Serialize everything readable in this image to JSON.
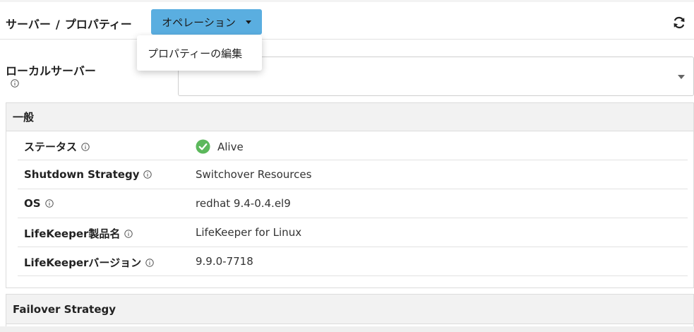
{
  "header": {
    "breadcrumb": [
      "サーバー",
      "プロパティー"
    ],
    "breadcrumb_separator": "/",
    "operation_button": "オペレーション",
    "refresh_icon": "refresh-icon"
  },
  "dropdown": {
    "items": [
      "プロパティーの編集"
    ]
  },
  "local_server": {
    "label": "ローカルサーバー",
    "value": ""
  },
  "general": {
    "title": "一般",
    "rows": [
      {
        "label": "ステータス",
        "value": "Alive"
      },
      {
        "label": "Shutdown Strategy",
        "value": "Switchover Resources"
      },
      {
        "label": "OS",
        "value": "redhat 9.4-0.4.el9"
      },
      {
        "label": "LifeKeeper製品名",
        "value": "LifeKeeper for Linux"
      },
      {
        "label": "LifeKeeperバージョン",
        "value": "9.9.0-7718"
      }
    ]
  },
  "failover": {
    "title": "Failover Strategy"
  },
  "colors": {
    "accent": "#5aaee0",
    "status_ok": "#5cb85c"
  }
}
